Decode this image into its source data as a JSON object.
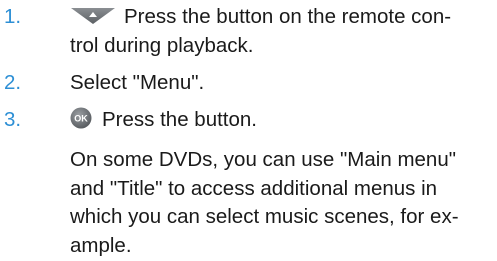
{
  "steps": [
    {
      "number": "1.",
      "icon": "down-triangle-button-icon",
      "text_line1": "Press the button on the remote con-",
      "text_line2": "trol during playback."
    },
    {
      "number": "2.",
      "text": "Select \"Menu\"."
    },
    {
      "number": "3.",
      "icon": "ok-button-icon",
      "icon_label": "OK",
      "text": "Press the button."
    }
  ],
  "note": {
    "line1": "On some DVDs, you can use \"Main menu\"",
    "line2": "and \"Title\" to access additional menus in",
    "line3": "which you can select music scenes, for ex-",
    "line4": "ample."
  },
  "colors": {
    "number": "#2d8fd5",
    "text": "#1a1a1a",
    "icon": "#6f7377"
  }
}
